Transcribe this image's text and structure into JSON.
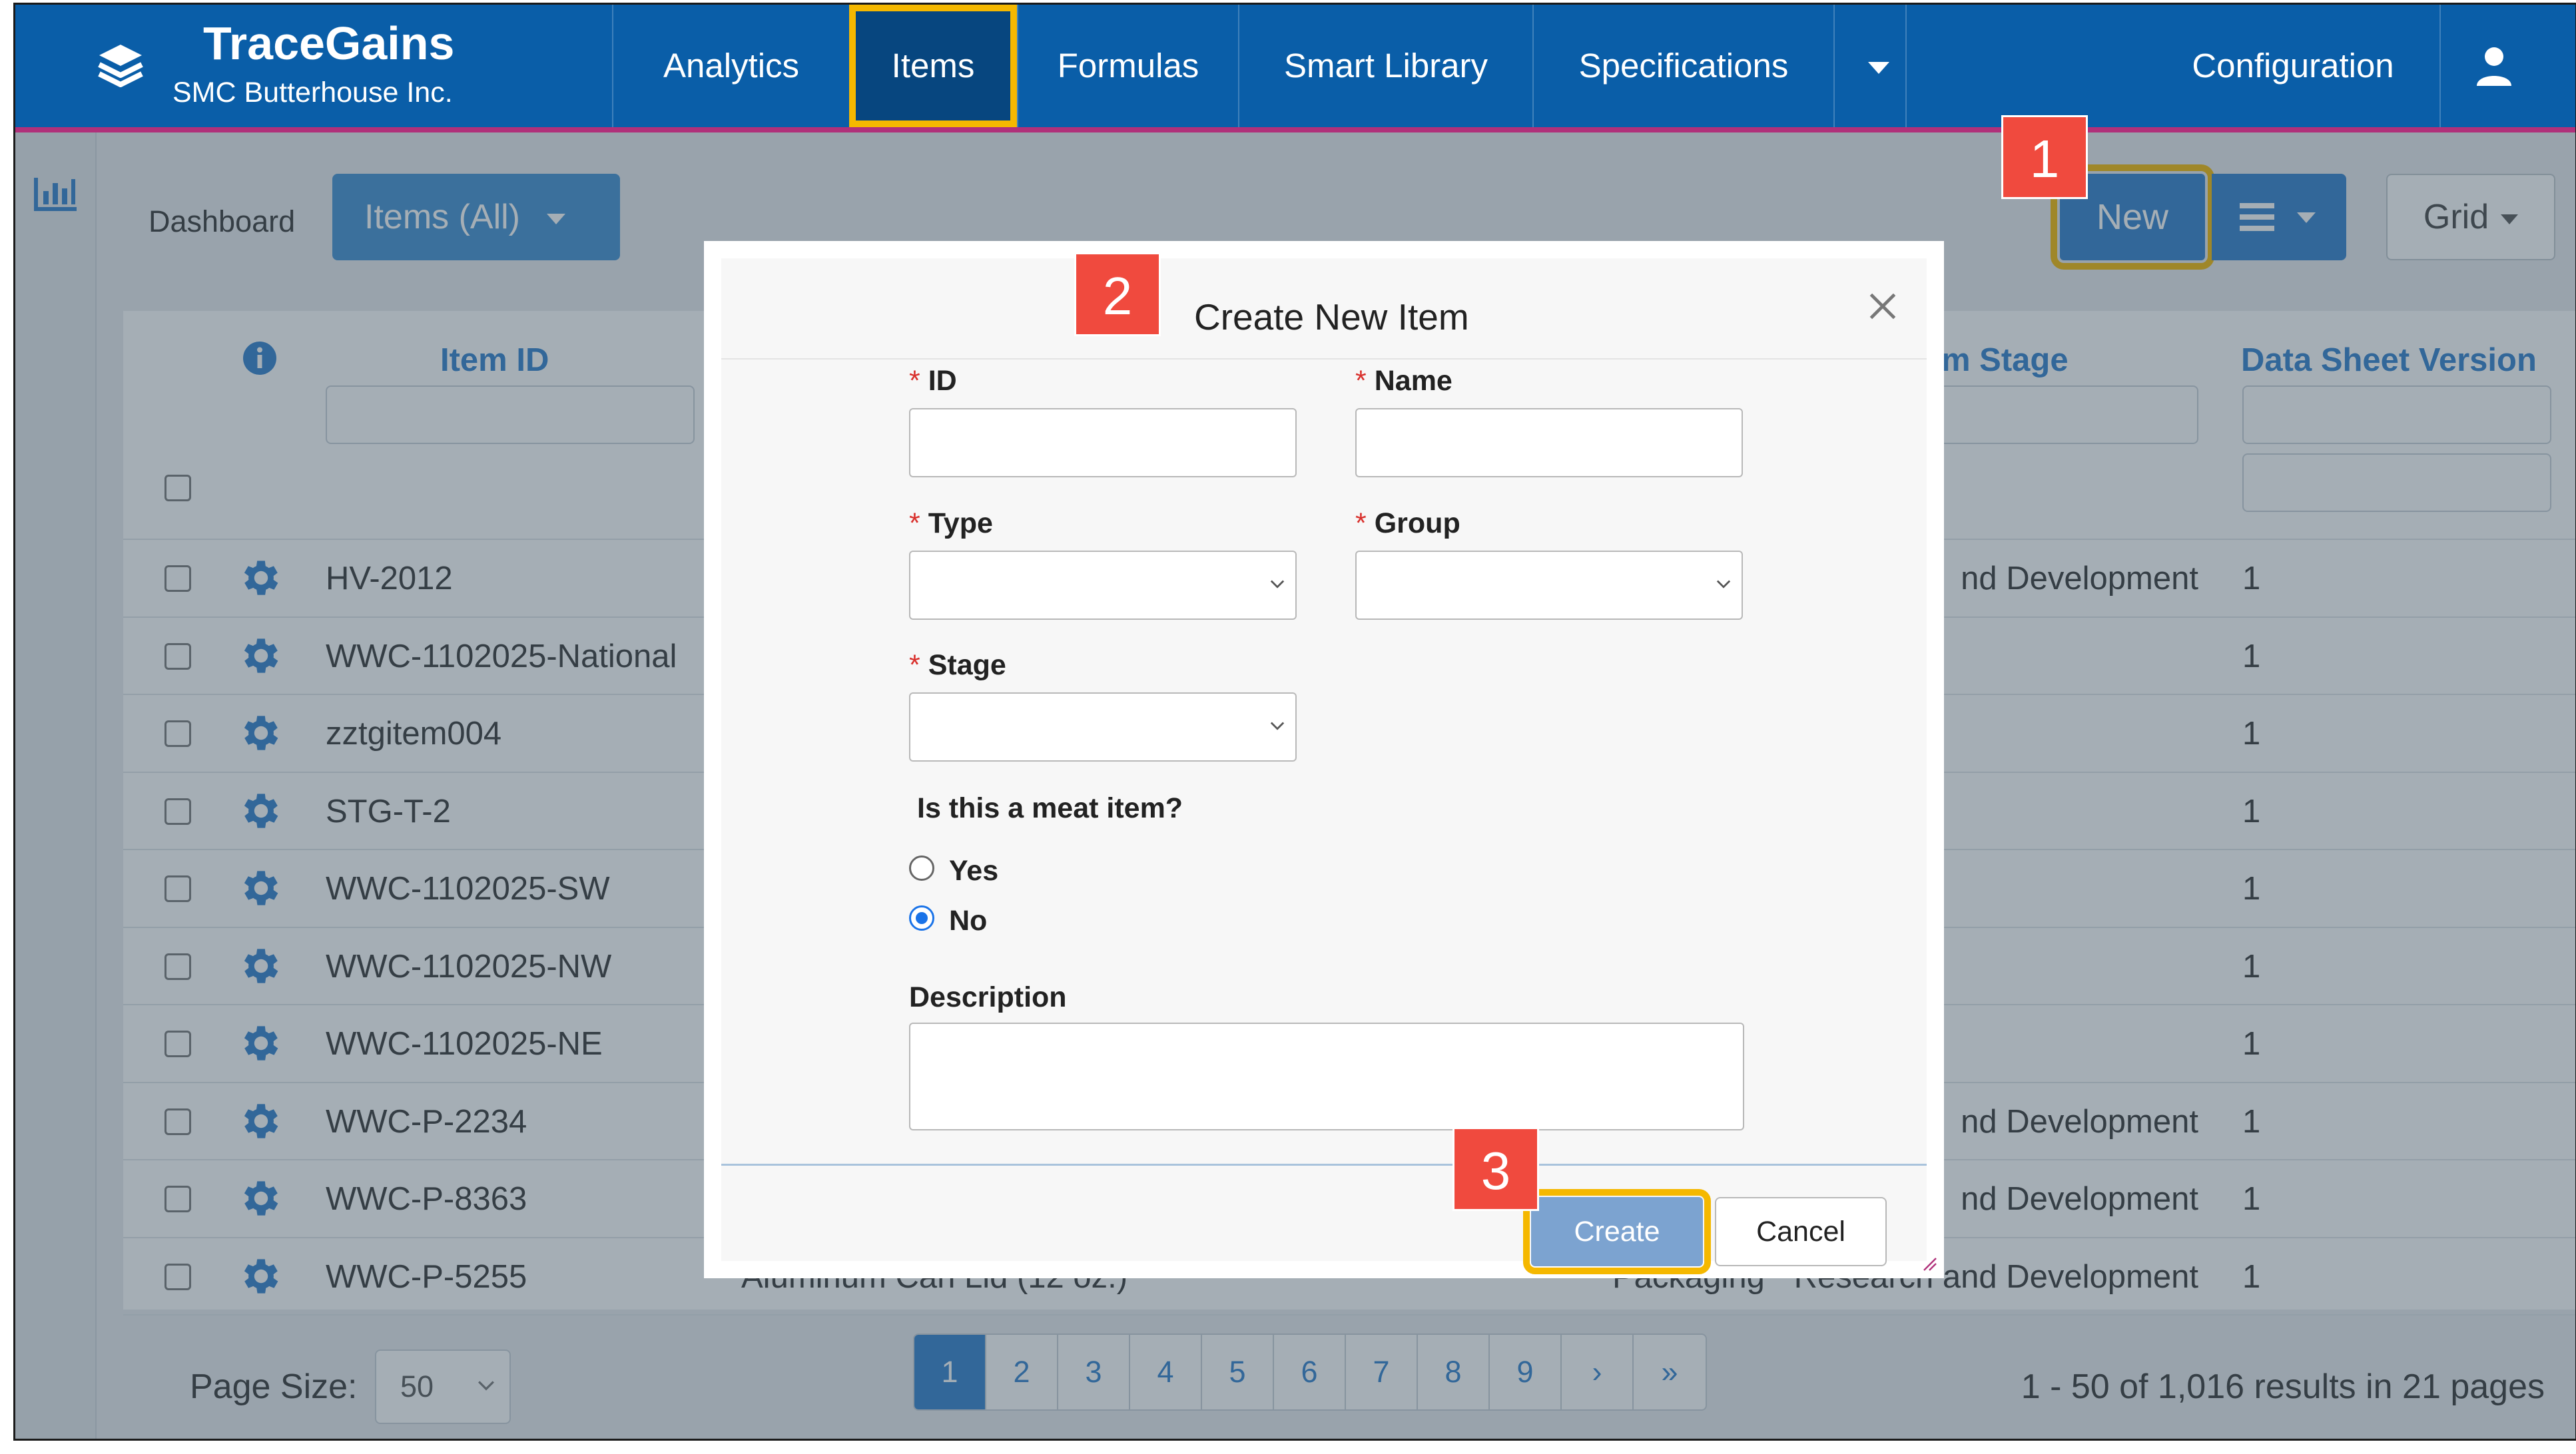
{
  "colors": {
    "nav_bg": "#0a5ea8",
    "accent": "#2f7fcc",
    "highlight": "#f5b800",
    "badge": "#f04a3e",
    "required": "#d9302c"
  },
  "brand": {
    "name": "TraceGains",
    "company": "SMC Butterhouse Inc.",
    "icon": "layers-icon"
  },
  "nav": {
    "items": [
      "Analytics",
      "Items",
      "Formulas",
      "Smart Library",
      "Specifications"
    ],
    "active": "Items",
    "configuration": "Configuration",
    "user_icon": "user-icon"
  },
  "toolbar": {
    "breadcrumb": "Dashboard",
    "view_dropdown": "Items (All)",
    "new_label": "New",
    "grid_label": "Grid"
  },
  "table": {
    "headers": {
      "item_id": "Item ID",
      "item_stage": "m Stage",
      "data_sheet_version": "Data Sheet Version"
    },
    "rows": [
      {
        "id": "HV-2012",
        "stage": "nd Development",
        "version": "1"
      },
      {
        "id": "WWC-1102025-National",
        "stage": "",
        "version": "1"
      },
      {
        "id": "zztgitem004",
        "stage": "",
        "version": "1"
      },
      {
        "id": "STG-T-2",
        "stage": "",
        "version": "1"
      },
      {
        "id": "WWC-1102025-SW",
        "stage": "",
        "version": "1"
      },
      {
        "id": "WWC-1102025-NW",
        "stage": "",
        "version": "1"
      },
      {
        "id": "WWC-1102025-NE",
        "stage": "",
        "version": "1"
      },
      {
        "id": "WWC-P-2234",
        "stage": "nd Development",
        "version": "1"
      },
      {
        "id": "WWC-P-8363",
        "stage": "nd Development",
        "version": "1"
      },
      {
        "id": "WWC-P-5255",
        "stage": "Research and Development",
        "version": "1",
        "name_partial": "Aluminum Can Lid (12 oz.)",
        "type_partial": "Packaging"
      }
    ]
  },
  "footer": {
    "page_size_label": "Page Size:",
    "page_size_value": "50",
    "pages": [
      "1",
      "2",
      "3",
      "4",
      "5",
      "6",
      "7",
      "8",
      "9",
      "›",
      "»"
    ],
    "current_page": "1",
    "results": "1 - 50 of 1,016 results in 21 pages"
  },
  "modal": {
    "title": "Create New Item",
    "fields": {
      "id": "ID",
      "name": "Name",
      "type": "Type",
      "group": "Group",
      "stage": "Stage",
      "description": "Description"
    },
    "required_mark": "*",
    "meat_question": "Is this a meat item?",
    "options": {
      "yes": "Yes",
      "no": "No"
    },
    "selected": "No",
    "create_label": "Create",
    "cancel_label": "Cancel"
  },
  "badges": [
    "1",
    "2",
    "3"
  ]
}
